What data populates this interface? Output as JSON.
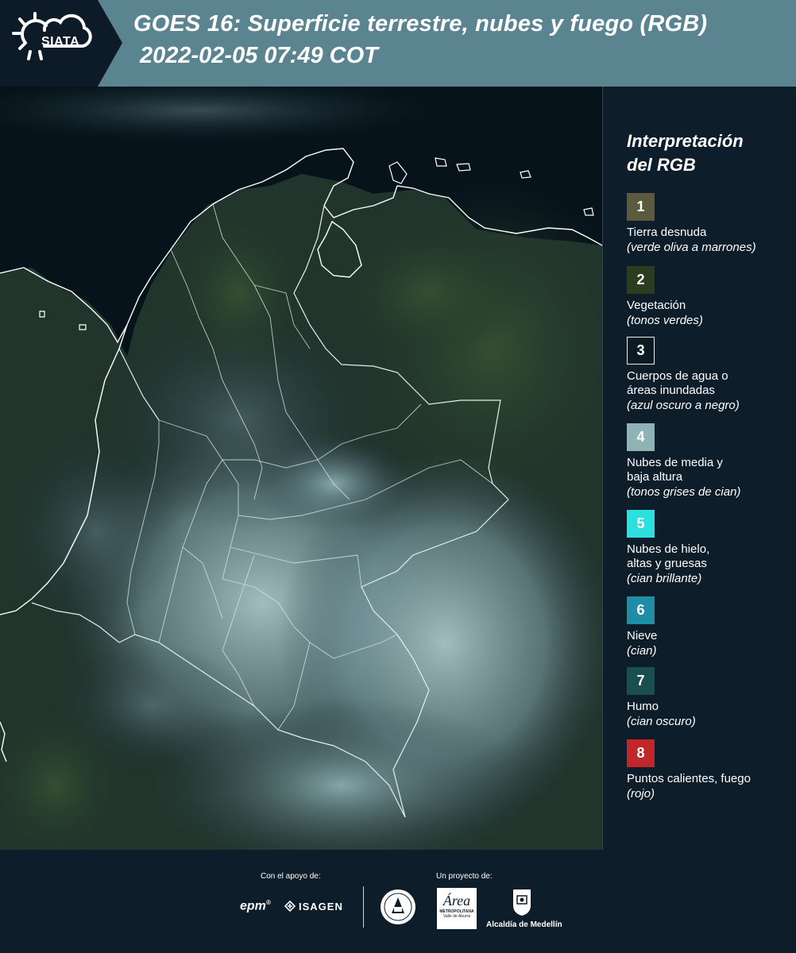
{
  "header": {
    "logo_text": "SIATA",
    "title_line1": "GOES 16: Superficie terrestre, nubes y fuego (RGB)",
    "title_line2": "2022-02-05 07:49 COT"
  },
  "legend": {
    "title_line1": "Interpretación",
    "title_line2": "del RGB",
    "items": [
      {
        "number": "1",
        "color": "#5c5a3e",
        "label": [
          "Tierra desnuda"
        ],
        "sub": "(verde oliva a marrones)"
      },
      {
        "number": "2",
        "color": "#2c3d1e",
        "label": [
          "Vegetación"
        ],
        "sub": "(tonos verdes)"
      },
      {
        "number": "3",
        "color": "#0c1a24",
        "label": [
          "Cuerpos de agua o",
          "áreas inundadas"
        ],
        "sub": "(azul oscuro a negro)"
      },
      {
        "number": "4",
        "color": "#8fb3b5",
        "label": [
          "Nubes de media y",
          "baja altura"
        ],
        "sub": "(tonos grises de cian)"
      },
      {
        "number": "5",
        "color": "#2ce0e0",
        "label": [
          "Nubes de hielo,",
          "altas y gruesas"
        ],
        "sub": "(cian brillante)"
      },
      {
        "number": "6",
        "color": "#1d8ea5",
        "label": [
          "Nieve"
        ],
        "sub": "(cian)"
      },
      {
        "number": "7",
        "color": "#1a4f4f",
        "label": [
          "Humo"
        ],
        "sub": "(cian oscuro)"
      },
      {
        "number": "8",
        "color": "#c0262a",
        "label": [
          "Puntos calientes, fuego"
        ],
        "sub": "(rojo)"
      }
    ]
  },
  "footer": {
    "support_caption": "Con el apoyo de:",
    "project_caption": "Un proyecto de:",
    "sponsors": [
      "epm",
      "ISAGEN"
    ],
    "partners": {
      "area_logo_text": "Área",
      "area_line1": "METROPOLITANA",
      "area_line2": "Valle de Aburrá",
      "alcaldia": "Alcaldía de Medellín"
    }
  }
}
